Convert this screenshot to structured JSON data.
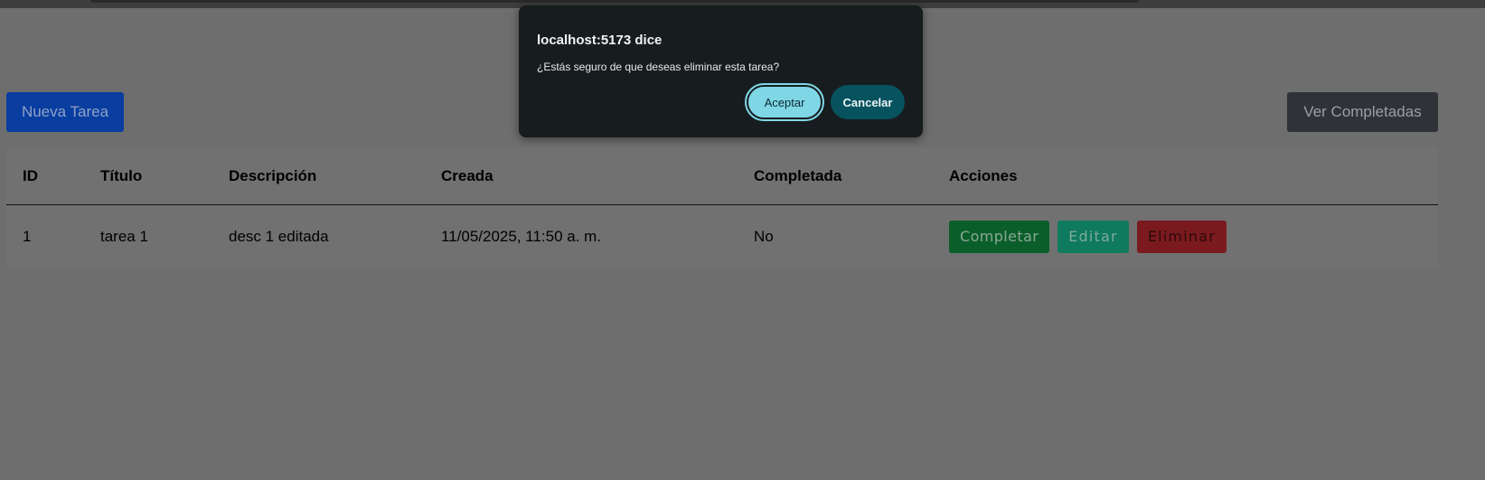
{
  "page": {
    "new_task_label": "Nueva Tarea",
    "view_completed_label": "Ver Completadas"
  },
  "table": {
    "headers": [
      "ID",
      "Título",
      "Descripción",
      "Creada",
      "Completada",
      "Acciones"
    ],
    "rows": [
      {
        "id": "1",
        "title": "tarea 1",
        "description": "desc 1 editada",
        "created": "11/05/2025, 11:50 a. m.",
        "completed": "No",
        "actions": {
          "complete": "Completar",
          "edit": "Editar",
          "delete": "Eliminar"
        }
      }
    ]
  },
  "dialog": {
    "title": "localhost:5173 dice",
    "message": "¿Estás seguro de que deseas eliminar esta tarea?",
    "accept_label": "Aceptar",
    "cancel_label": "Cancelar"
  },
  "colors": {
    "overlay_bg": "#6e6e6e",
    "new_task_bg": "#093da0",
    "view_completed_bg": "#2f3237",
    "complete_bg": "#0a5e2a",
    "edit_bg": "#0f7a5e",
    "delete_bg": "#7b1a1e",
    "dialog_bg": "#171c1f",
    "accept_bg": "#7fd7e6",
    "cancel_bg": "#06525e"
  }
}
